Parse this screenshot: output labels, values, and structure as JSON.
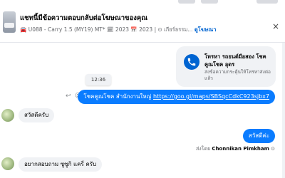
{
  "header": {
    "title": "แชทนี้มีข้อความตอบกลับต่อโฆษณาของคุณ",
    "subtitle": "🚘 U088 - Carry 1.5 (MY19) MT* 🗓 2023 📅 2023 | ⊙ เกียร์ธรรม...",
    "view_ad_link": "ดูโฆษณา",
    "close_label": "×"
  },
  "ad_card": {
    "title": "โทรหา รถยนต์มือสอง โชคคูณโชค อุดร",
    "note": "ส่งข้อความกระตุ้นให้โทรหาส่งต่อแล้ว"
  },
  "messages": {
    "timestamp": "12:36",
    "outgoing_1_text": "โชคคูณโชค สำนักงานใหญ่ ",
    "outgoing_1_url": "https://goo.gl/maps/SBSqcCdkC923sjbx7",
    "incoming_1": "สวัสดีครับ",
    "outgoing_2": "สวัสดีค่ะ",
    "sent_by_prefix": "ส่งโดย",
    "sent_by_name": "Chonnikan Pimkham",
    "sent_icon": "⊙",
    "incoming_2": "อยากสอบถาม ซูซูกิ แครี่ ครับ"
  },
  "icons": {
    "reply": "↩",
    "react": "☺"
  },
  "colors": {
    "accent": "#0a7cff",
    "link": "#0064d1",
    "bubble_in": "#f0f2f5"
  }
}
